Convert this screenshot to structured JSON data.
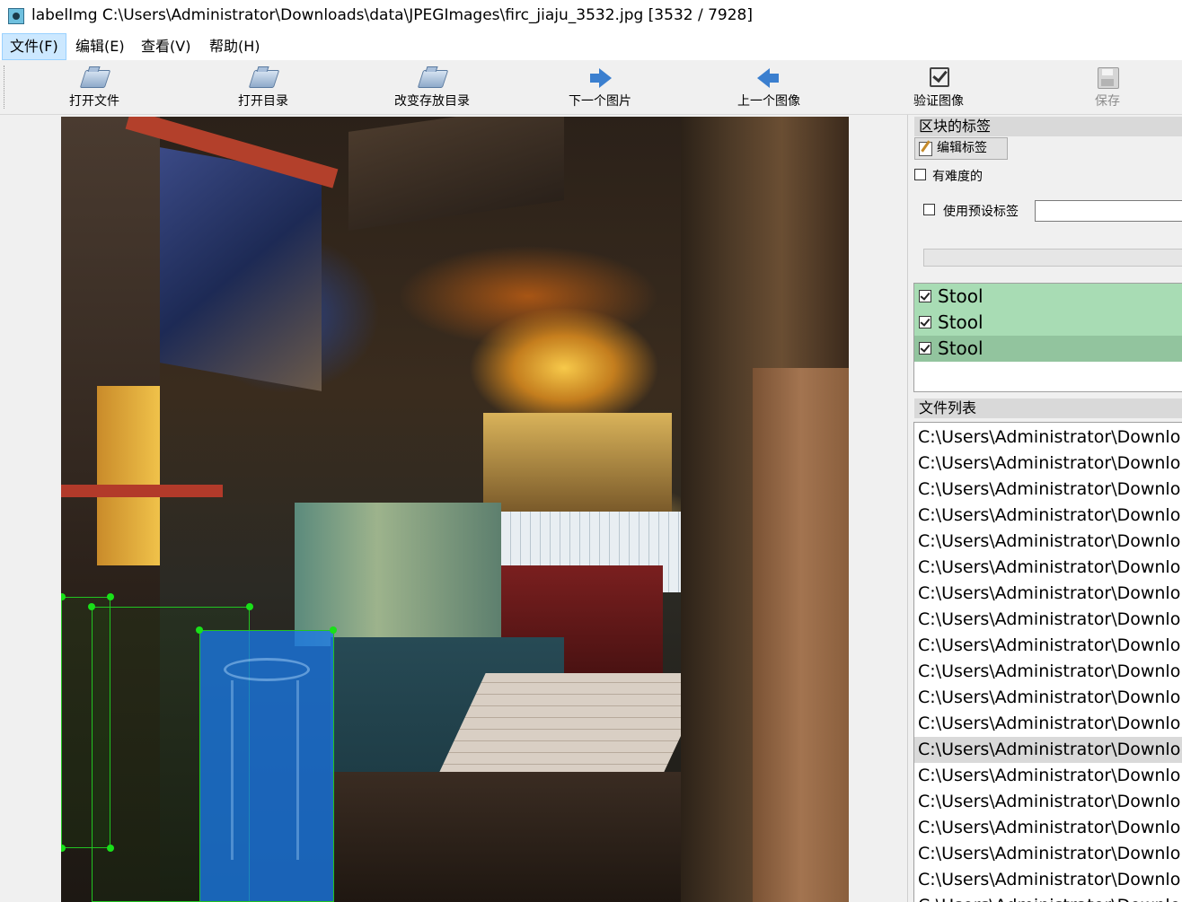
{
  "window": {
    "title": "labelImg C:\\Users\\Administrator\\Downloads\\data\\JPEGImages\\firc_jiaju_3532.jpg [3532 / 7928]",
    "icon": "labelimg-app-icon"
  },
  "menu": [
    {
      "label": "文件(F)",
      "active": true
    },
    {
      "label": "编辑(E)"
    },
    {
      "label": "查看(V)"
    },
    {
      "label": "帮助(H)"
    }
  ],
  "toolbar": {
    "open_file": "打开文件",
    "open_dir": "打开目录",
    "change_save_dir": "改变存放目录",
    "next_image": "下一个图片",
    "prev_image": "上一个图像",
    "verify_image": "验证图像",
    "save": "保存",
    "icons": {
      "open_file": "folder-open-icon",
      "open_dir": "folder-open-icon",
      "change_save_dir": "folder-open-icon",
      "next_image": "arrow-right-icon",
      "prev_image": "arrow-left-icon",
      "verify_image": "checkbox-icon",
      "save": "floppy-disk-icon"
    }
  },
  "colors": {
    "label_row_bg": "#a8dcb4",
    "label_row_selected_bg": "#92c49e",
    "box_fill_selected": "#1978e6",
    "box_outline": "#22c422"
  },
  "dock": {
    "box_labels_title": "区块的标签",
    "edit_label_button": "编辑标签",
    "difficult_label": "有难度的",
    "use_default_label": "使用预设标签",
    "default_label_value": "",
    "labels": [
      {
        "text": "Stool",
        "checked": true,
        "selected": false
      },
      {
        "text": "Stool",
        "checked": true,
        "selected": false
      },
      {
        "text": "Stool",
        "checked": true,
        "selected": true
      }
    ],
    "file_list_title": "文件列表",
    "files": [
      "C:\\Users\\Administrator\\Downlo",
      "C:\\Users\\Administrator\\Downlo",
      "C:\\Users\\Administrator\\Downlo",
      "C:\\Users\\Administrator\\Downlo",
      "C:\\Users\\Administrator\\Downlo",
      "C:\\Users\\Administrator\\Downlo",
      "C:\\Users\\Administrator\\Downlo",
      "C:\\Users\\Administrator\\Downlo",
      "C:\\Users\\Administrator\\Downlo",
      "C:\\Users\\Administrator\\Downlo",
      "C:\\Users\\Administrator\\Downlo",
      "C:\\Users\\Administrator\\Downlo",
      "C:\\Users\\Administrator\\Downlo",
      "C:\\Users\\Administrator\\Downlo",
      "C:\\Users\\Administrator\\Downlo",
      "C:\\Users\\Administrator\\Downlo",
      "C:\\Users\\Administrator\\Downlo",
      "C:\\Users\\Administrator\\Downlo",
      "C:\\Users\\Administrator\\Downlo"
    ],
    "selected_file_index": 12
  }
}
